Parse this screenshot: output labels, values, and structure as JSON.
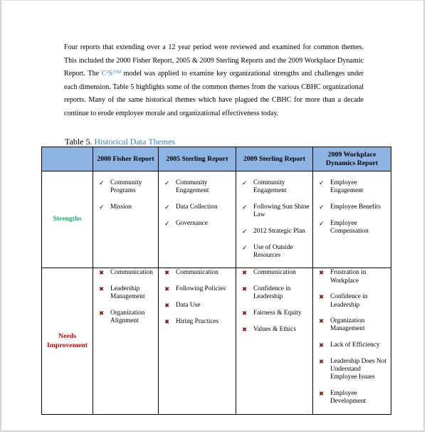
{
  "paragraph": {
    "before_model": "Four reports that extending over a 12 year period were reviewed and examined for common themes. This included the 2000 Fisher Report, 2005 & 2009 Sterling Reports and the 2009 Workplace Dynamic Report.  The ",
    "model_name": "C",
    "model_sup1": "2",
    "model_s": "S",
    "model_sup2": "2TM",
    "after_model": " model was applied to examine key organizational strengths and challenges under each dimension. Table 5 highlights some of the common themes from the various CBHC organizational reports.   Many of the same historical themes which have plagued the CBHC for more than a decade continue to erode employee morale and organizational effectiveness today."
  },
  "caption": {
    "label": "Table 5.",
    "title": "Historical Data Themes"
  },
  "colors": {
    "header_bg": "#8eb4e3",
    "strengths": "#17b35b",
    "needs_improvement": "#cc0000",
    "x_mark": "#8b0f0f",
    "model_link": "#1f7fd4"
  },
  "icons": {
    "check": "✓",
    "x": "✖"
  },
  "table": {
    "headers": [
      "",
      "2000 Fisher Report",
      "2005 Sterling Report",
      "2009 Sterling Report",
      "2009 Workplace Dynamics Report"
    ],
    "rows": [
      {
        "label": "Strengths",
        "cells": [
          [
            "Community Programs",
            "Mission"
          ],
          [
            "Community Engagement",
            "Data Collection",
            "Governance"
          ],
          [
            "Community Engagement",
            "Following Sun Shine Law",
            "2012 Strategic Plan",
            "Use of Outside Resources"
          ],
          [
            "Employee Engagement",
            "Employee Benefits",
            "Employee Compensation"
          ]
        ]
      },
      {
        "label": "Needs Improvement",
        "cells": [
          [
            "Communication",
            "Leadership Management",
            "Organization Alignment"
          ],
          [
            "Communication",
            "Following Policies",
            "Data Use",
            "Hiring Practices"
          ],
          [
            "Communication",
            "Confidence in Leadership",
            "Fairness & Equity",
            "Values & Ethics"
          ],
          [
            "Frustration in Workplace",
            "Confidence in Leadership",
            "Organization Management",
            "Lack  of Efficiency",
            "Leadership Does Not Understand Employee Issues",
            "Employee Development"
          ]
        ]
      }
    ]
  }
}
